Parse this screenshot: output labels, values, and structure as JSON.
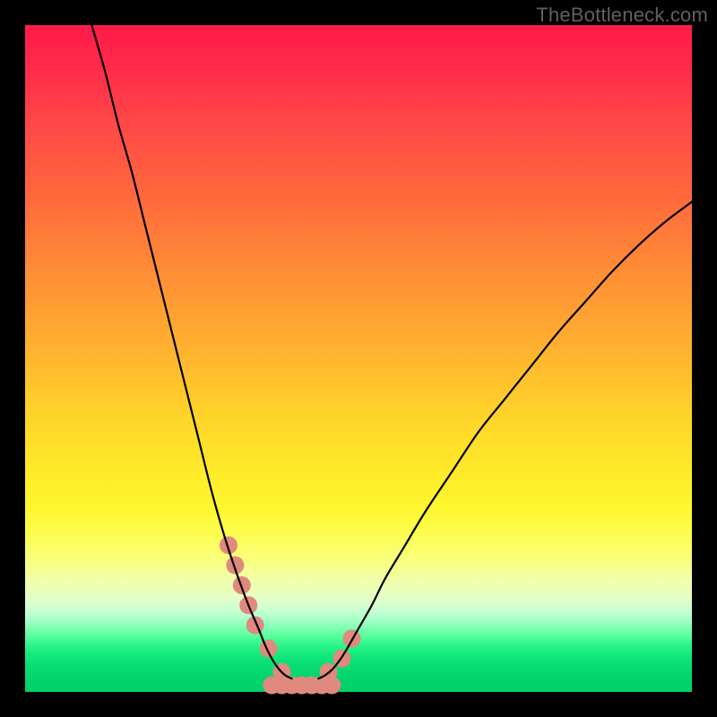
{
  "watermark": "TheBottleneck.com",
  "chart_data": {
    "type": "line",
    "title": "",
    "xlabel": "",
    "ylabel": "",
    "xlim": [
      0,
      100
    ],
    "ylim": [
      0,
      100
    ],
    "grid": false,
    "series": [
      {
        "name": "left-curve",
        "x": [
          10,
          12,
          14,
          16,
          18,
          20,
          22,
          24,
          26,
          28,
          30,
          32,
          33.5,
          35,
          36,
          37,
          38,
          39,
          40
        ],
        "y": [
          100,
          93,
          85,
          78,
          70,
          62,
          54,
          46,
          38,
          30,
          23,
          17,
          13,
          9.5,
          7,
          5,
          3.5,
          2.5,
          2
        ],
        "stroke": "#000000",
        "width": 2.2
      },
      {
        "name": "right-curve",
        "x": [
          44,
          45,
          46,
          47,
          48,
          50,
          52,
          54,
          57,
          60,
          64,
          68,
          72,
          76,
          80,
          84,
          88,
          92,
          96,
          100
        ],
        "y": [
          2,
          2.5,
          3.3,
          4.5,
          6,
          9.5,
          13,
          17,
          22,
          27,
          33,
          39,
          44,
          49,
          54,
          58.5,
          63,
          67,
          70.5,
          73.5
        ],
        "stroke": "#000000",
        "width": 2.2
      },
      {
        "name": "left-dots",
        "type": "scatter",
        "x": [
          30.5,
          31.5,
          32.5,
          33.5,
          34.5,
          36.5,
          38.5
        ],
        "y": [
          22,
          19,
          16,
          13,
          10,
          6.5,
          3
        ],
        "color": "#e0897f",
        "r": 10
      },
      {
        "name": "right-dots",
        "type": "scatter",
        "x": [
          45.5,
          47.5,
          49.0
        ],
        "y": [
          3,
          5,
          8
        ],
        "color": "#e0897f",
        "r": 10
      },
      {
        "name": "bottom-blob",
        "type": "scatter",
        "x": [
          37,
          38.5,
          40,
          41.5,
          43,
          44.5,
          46
        ],
        "y": [
          1.0,
          1.0,
          1.0,
          1.0,
          1.0,
          1.0,
          1.0
        ],
        "color": "#e0897f",
        "r": 10
      }
    ],
    "gradient_stops": [
      {
        "pos": 0.0,
        "color": "#ff1a4a"
      },
      {
        "pos": 0.36,
        "color": "#ff8a36"
      },
      {
        "pos": 0.72,
        "color": "#fff62d"
      },
      {
        "pos": 0.9,
        "color": "#5cff9e"
      },
      {
        "pos": 1.0,
        "color": "#02cf68"
      }
    ]
  }
}
